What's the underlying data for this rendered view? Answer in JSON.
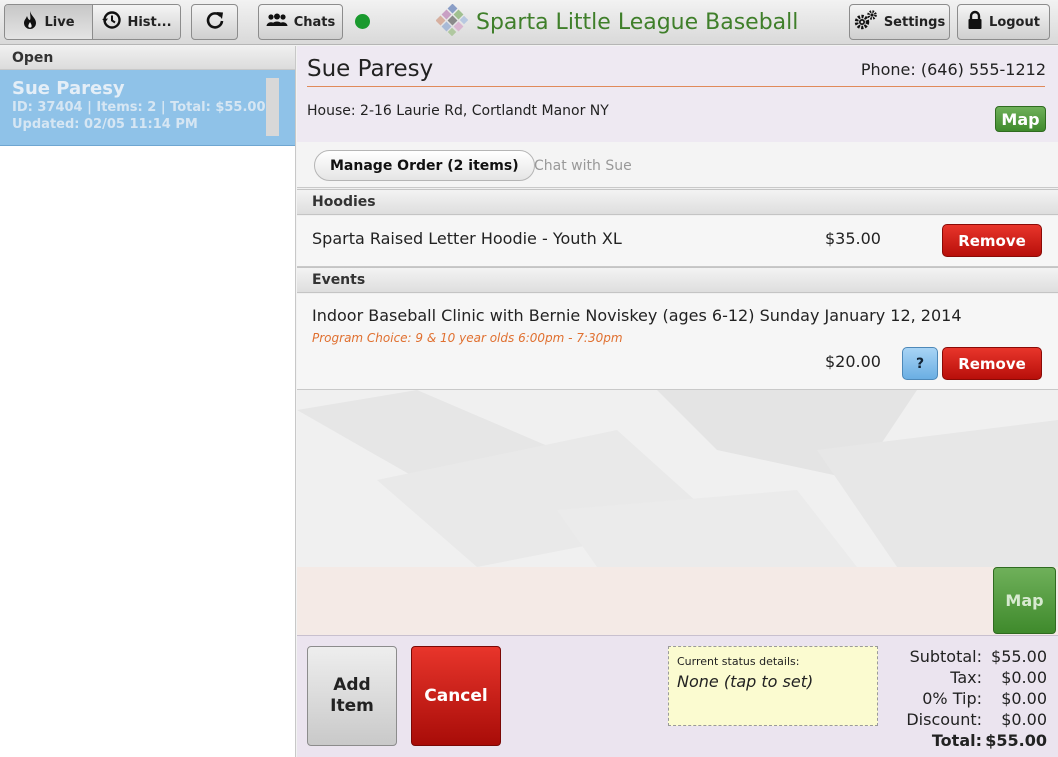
{
  "topbar": {
    "live_label": "Live",
    "history_label": "Hist...",
    "chats_label": "Chats",
    "settings_label": "Settings",
    "logout_label": "Logout",
    "status_color": "#1a9a2e",
    "brand_title": "Sparta Little League Baseball",
    "icons": [
      "fire-icon",
      "history-icon",
      "refresh-icon",
      "people-icon",
      "gear-icon",
      "lock-icon"
    ]
  },
  "sidebar": {
    "section_label": "Open",
    "orders": [
      {
        "name": "Sue Paresy",
        "meta1": "ID: 37404 | Items: 2 | Total: $55.00",
        "meta2": "Updated: 02/05 11:14 PM"
      }
    ]
  },
  "customer": {
    "name": "Sue Paresy",
    "phone": "Phone: (646) 555-1212",
    "address": "House: 2-16 Laurie Rd, Cortlandt Manor NY",
    "map_label": "Map"
  },
  "tabs": [
    {
      "label": "Manage Order (2 items)",
      "active": true
    },
    {
      "label": "Chat with Sue",
      "active": false
    }
  ],
  "order": {
    "sections": [
      {
        "title": "Hoodies",
        "items": [
          {
            "name": "Sparta Raised Letter Hoodie - Youth XL",
            "price": "$35.00",
            "remove_label": "Remove"
          }
        ]
      },
      {
        "title": "Events",
        "items": [
          {
            "name": "Indoor Baseball Clinic with Bernie Noviskey (ages 6-12) Sunday January 12, 2014",
            "option": "Program Choice: 9 & 10 year olds 6:00pm - 7:30pm",
            "price": "$20.00",
            "info_label": "?",
            "remove_label": "Remove"
          }
        ]
      }
    ],
    "map_label": "Map"
  },
  "footer": {
    "add_label_line1": "Add",
    "add_label_line2": "Item",
    "cancel_label": "Cancel",
    "status_label": "Current status details:",
    "status_value": "None (tap to set)",
    "totals": [
      {
        "label": "Subtotal:",
        "value": "$55.00"
      },
      {
        "label": "Tax:",
        "value": "$0.00"
      },
      {
        "label": "0% Tip:",
        "value": "$0.00"
      },
      {
        "label": "Discount:",
        "value": "$0.00"
      },
      {
        "label": "Total:",
        "value": "$55.00"
      }
    ]
  },
  "colors": {
    "brand_green": "#3f7f2a",
    "selected_order": "#8fc2e8",
    "remove_red": "#c8201a",
    "status_yellow": "#fbfbd0"
  }
}
